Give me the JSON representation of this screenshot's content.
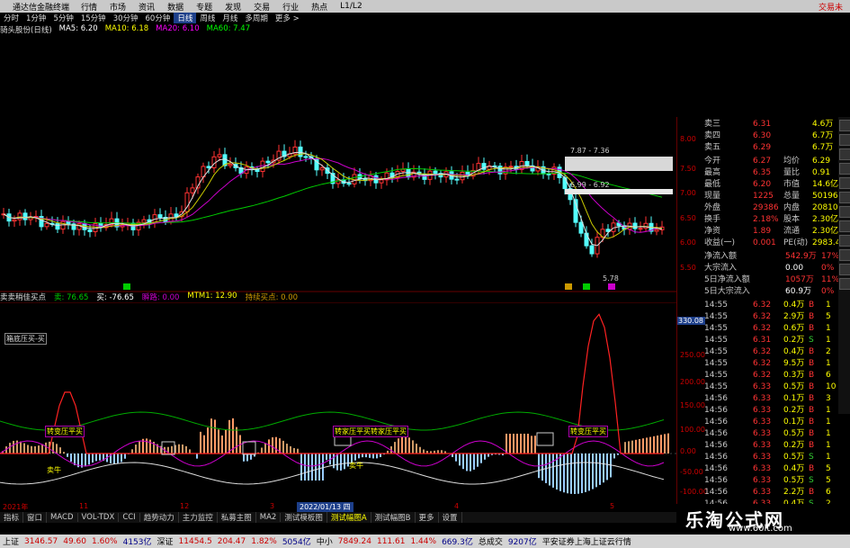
{
  "menubar": {
    "brand": "通达信金融终端",
    "items": [
      "行情",
      "市场",
      "资讯",
      "数据",
      "专题",
      "发现",
      "交易",
      "行业",
      "热点",
      "L1/L2"
    ],
    "right": "交易未"
  },
  "tabbar": [
    "分时",
    "1分钟",
    "5分钟",
    "15分钟",
    "30分钟",
    "60分钟",
    "日线",
    "周线",
    "月线",
    "多周期",
    "更多 >"
  ],
  "ma_legend": {
    "title": "骑头股份(日线)",
    "ma5": "MA5: 6.20",
    "ma10": "MA10: 6.18",
    "ma20": "MA20: 6.10",
    "ma60": "MA60: 7.47"
  },
  "colors": {
    "ma5": "#ffffff",
    "ma10": "#ffff00",
    "ma20": "#ff00ff",
    "ma60": "#00ff00",
    "up": "#ff3232",
    "down": "#54ffff"
  },
  "candle_tags": {
    "t1": "7.87 - 7.36",
    "t2": "6.99 - 6.92",
    "t3": "5.78"
  },
  "price_axis": [
    "8.00",
    "7.50",
    "7.00",
    "6.50",
    "6.00",
    "5.50"
  ],
  "ind_legend": {
    "name": "卖卖稍佳买点",
    "a": "卖: 76.65",
    "b": "买: -76.65",
    "c": "瞬路: 0.00",
    "d": "MTM1: 12.90",
    "e": "持续买点: 0.00"
  },
  "lower_axis": [
    "330.08",
    "250.00",
    "200.00",
    "150.00",
    "100.00",
    "50.00",
    "0.00",
    "-50.00",
    "-100.00"
  ],
  "lower_tags": {
    "box": "箱底压买-买",
    "buy1": "转变压平买",
    "buy2": "转家压平买转家压平买",
    "buy3": "转变压平买",
    "sell": "卖牛",
    "tag2": "卖牛"
  },
  "time_axis": [
    "2021年",
    "11",
    "12",
    "3",
    "4",
    "5"
  ],
  "datebox": "2022/01/13 四",
  "indicator_tabs": [
    "指标",
    "窗口",
    "MACD",
    "VOL-TDX",
    "CCI",
    "趋势动力",
    "主力监控",
    "私募主图",
    "MA2",
    "测试模板图",
    "测试幅图A",
    "测试幅图B",
    "更多",
    "设置"
  ],
  "quote": {
    "top_rows": [
      [
        "卖三",
        "6.31",
        "4.6万"
      ],
      [
        "卖四",
        "6.30",
        "6.7万"
      ],
      [
        "卖五",
        "6.29",
        "6.7万"
      ]
    ],
    "stats": [
      [
        "今开",
        "6.27",
        "均价",
        "6.29"
      ],
      [
        "最高",
        "6.35",
        "量比",
        "0.91"
      ],
      [
        "最低",
        "6.20",
        "市值",
        "14.6亿"
      ],
      [
        "现量",
        "1225",
        "总量",
        "50196"
      ],
      [
        "外盘",
        "29386",
        "内盘",
        "20810"
      ],
      [
        "换手",
        "2.18%",
        "股本",
        "2.30亿"
      ],
      [
        "净资",
        "1.89",
        "流通",
        "2.30亿"
      ],
      [
        "收益(一)",
        "0.001",
        "PE(动)",
        "2983.4"
      ]
    ],
    "flows": [
      [
        "净流入额",
        "542.9万",
        "17%"
      ],
      [
        "大宗流入",
        "0.00",
        "0%"
      ],
      [
        "5日净流入额",
        "1057万",
        "11%"
      ],
      [
        "5日大宗流入",
        "60.9万",
        "0%"
      ]
    ],
    "ticks": [
      [
        "14:55",
        "6.32",
        "0.4万",
        "B",
        "1"
      ],
      [
        "14:55",
        "6.32",
        "2.9万",
        "B",
        "5"
      ],
      [
        "14:55",
        "6.32",
        "0.6万",
        "B",
        "1"
      ],
      [
        "14:55",
        "6.31",
        "0.2万",
        "S",
        "1"
      ],
      [
        "14:55",
        "6.32",
        "0.4万",
        "B",
        "2"
      ],
      [
        "14:55",
        "6.32",
        "9.5万",
        "B",
        "1"
      ],
      [
        "14:55",
        "6.32",
        "0.3万",
        "B",
        "6"
      ],
      [
        "14:55",
        "6.33",
        "0.5万",
        "B",
        "10"
      ],
      [
        "14:56",
        "6.33",
        "0.1万",
        "B",
        "3"
      ],
      [
        "14:56",
        "6.33",
        "0.2万",
        "B",
        "1"
      ],
      [
        "14:56",
        "6.33",
        "0.1万",
        "B",
        "1"
      ],
      [
        "14:56",
        "6.33",
        "0.5万",
        "B",
        "1"
      ],
      [
        "14:56",
        "6.33",
        "0.2万",
        "B",
        "1"
      ],
      [
        "14:56",
        "6.33",
        "0.5万",
        "S",
        "1"
      ],
      [
        "14:56",
        "6.33",
        "0.4万",
        "B",
        "5"
      ],
      [
        "14:56",
        "6.33",
        "0.5万",
        "S",
        "5"
      ],
      [
        "14:56",
        "6.33",
        "2.2万",
        "B",
        "6"
      ],
      [
        "14:56",
        "6.33",
        "0.4万",
        "S",
        "2"
      ]
    ]
  },
  "statusbar": [
    {
      "t": "上证",
      "c": "l"
    },
    {
      "t": "3146.57",
      "c": "r"
    },
    {
      "t": "49.60",
      "c": "r"
    },
    {
      "t": "1.60%",
      "c": "r"
    },
    {
      "t": "4153亿",
      "c": "bl"
    },
    {
      "t": "深证",
      "c": "l"
    },
    {
      "t": "11454.5",
      "c": "r"
    },
    {
      "t": "204.47",
      "c": "r"
    },
    {
      "t": "1.82%",
      "c": "r"
    },
    {
      "t": "5054亿",
      "c": "bl"
    },
    {
      "t": "中小",
      "c": "l"
    },
    {
      "t": "7849.24",
      "c": "r"
    },
    {
      "t": "111.61",
      "c": "r"
    },
    {
      "t": "1.44%",
      "c": "r"
    },
    {
      "t": "669.3亿",
      "c": "bl"
    },
    {
      "t": "总成交",
      "c": "l"
    },
    {
      "t": "9207亿",
      "c": "bl"
    },
    {
      "t": "平安证券上海上证云行情",
      "c": "l"
    }
  ],
  "watermark": {
    "title": "乐淘公式网",
    "url": "www.60lt.com"
  },
  "ybox": "330.08"
}
